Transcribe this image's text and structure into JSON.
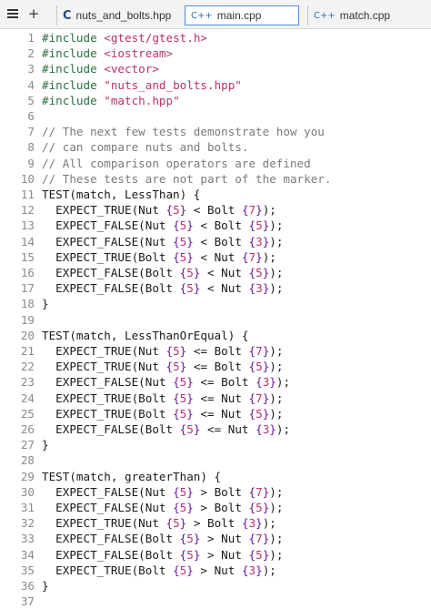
{
  "tabbar": {
    "new_tab_label": "+",
    "tabs": [
      {
        "label": "nuts_and_bolts.hpp",
        "icon": "c-file-icon",
        "active": false
      },
      {
        "label": "main.cpp",
        "icon": "cpp-file-icon",
        "active": true
      },
      {
        "label": "match.cpp",
        "icon": "cpp-file-icon",
        "active": false
      }
    ],
    "icon_glyphs": {
      "c": "C",
      "cpp": "C++"
    }
  },
  "colors": {
    "preprocessor": "#2c6e3f",
    "string": "#b8326f",
    "comment": "#7a7a7a",
    "number": "#b8326f",
    "active_tab_border": "#4a90e2"
  },
  "editor": {
    "lines": [
      {
        "n": "1",
        "text": "#include <gtest/gtest.h>",
        "kind": "include"
      },
      {
        "n": "2",
        "text": "#include <iostream>",
        "kind": "include"
      },
      {
        "n": "3",
        "text": "#include <vector>",
        "kind": "include"
      },
      {
        "n": "4",
        "text": "#include \"nuts_and_bolts.hpp\"",
        "kind": "include"
      },
      {
        "n": "5",
        "text": "#include \"match.hpp\"",
        "kind": "include"
      },
      {
        "n": "6",
        "text": "",
        "kind": "blank"
      },
      {
        "n": "7",
        "text": "// The next few tests demonstrate how you",
        "kind": "comment"
      },
      {
        "n": "8",
        "text": "// can compare nuts and bolts.",
        "kind": "comment"
      },
      {
        "n": "9",
        "text": "// All comparison operators are defined",
        "kind": "comment"
      },
      {
        "n": "10",
        "text": "// These tests are not part of the marker.",
        "kind": "comment"
      },
      {
        "n": "11",
        "text": "TEST(match, LessThan) {",
        "kind": "code"
      },
      {
        "n": "12",
        "text": "  EXPECT_TRUE(Nut {5} < Bolt {7});",
        "kind": "code"
      },
      {
        "n": "13",
        "text": "  EXPECT_FALSE(Nut {5} < Bolt {5});",
        "kind": "code"
      },
      {
        "n": "14",
        "text": "  EXPECT_FALSE(Nut {5} < Bolt {3});",
        "kind": "code"
      },
      {
        "n": "15",
        "text": "  EXPECT_TRUE(Bolt {5} < Nut {7});",
        "kind": "code"
      },
      {
        "n": "16",
        "text": "  EXPECT_FALSE(Bolt {5} < Nut {5});",
        "kind": "code"
      },
      {
        "n": "17",
        "text": "  EXPECT_FALSE(Bolt {5} < Nut {3});",
        "kind": "code"
      },
      {
        "n": "18",
        "text": "}",
        "kind": "code"
      },
      {
        "n": "19",
        "text": "",
        "kind": "blank"
      },
      {
        "n": "20",
        "text": "TEST(match, LessThanOrEqual) {",
        "kind": "code"
      },
      {
        "n": "21",
        "text": "  EXPECT_TRUE(Nut {5} <= Bolt {7});",
        "kind": "code"
      },
      {
        "n": "22",
        "text": "  EXPECT_TRUE(Nut {5} <= Bolt {5});",
        "kind": "code"
      },
      {
        "n": "23",
        "text": "  EXPECT_FALSE(Nut {5} <= Bolt {3});",
        "kind": "code"
      },
      {
        "n": "24",
        "text": "  EXPECT_TRUE(Bolt {5} <= Nut {7});",
        "kind": "code"
      },
      {
        "n": "25",
        "text": "  EXPECT_TRUE(Bolt {5} <= Nut {5});",
        "kind": "code"
      },
      {
        "n": "26",
        "text": "  EXPECT_FALSE(Bolt {5} <= Nut {3});",
        "kind": "code"
      },
      {
        "n": "27",
        "text": "}",
        "kind": "code"
      },
      {
        "n": "28",
        "text": "",
        "kind": "blank"
      },
      {
        "n": "29",
        "text": "TEST(match, greaterThan) {",
        "kind": "code"
      },
      {
        "n": "30",
        "text": "  EXPECT_FALSE(Nut {5} > Bolt {7});",
        "kind": "code"
      },
      {
        "n": "31",
        "text": "  EXPECT_FALSE(Nut {5} > Bolt {5});",
        "kind": "code"
      },
      {
        "n": "32",
        "text": "  EXPECT_TRUE(Nut {5} > Bolt {3});",
        "kind": "code"
      },
      {
        "n": "33",
        "text": "  EXPECT_FALSE(Bolt {5} > Nut {7});",
        "kind": "code"
      },
      {
        "n": "34",
        "text": "  EXPECT_FALSE(Bolt {5} > Nut {5});",
        "kind": "code"
      },
      {
        "n": "35",
        "text": "  EXPECT_TRUE(Bolt {5} > Nut {3});",
        "kind": "code"
      },
      {
        "n": "36",
        "text": "}",
        "kind": "code"
      },
      {
        "n": "37",
        "text": "",
        "kind": "blank"
      }
    ]
  }
}
